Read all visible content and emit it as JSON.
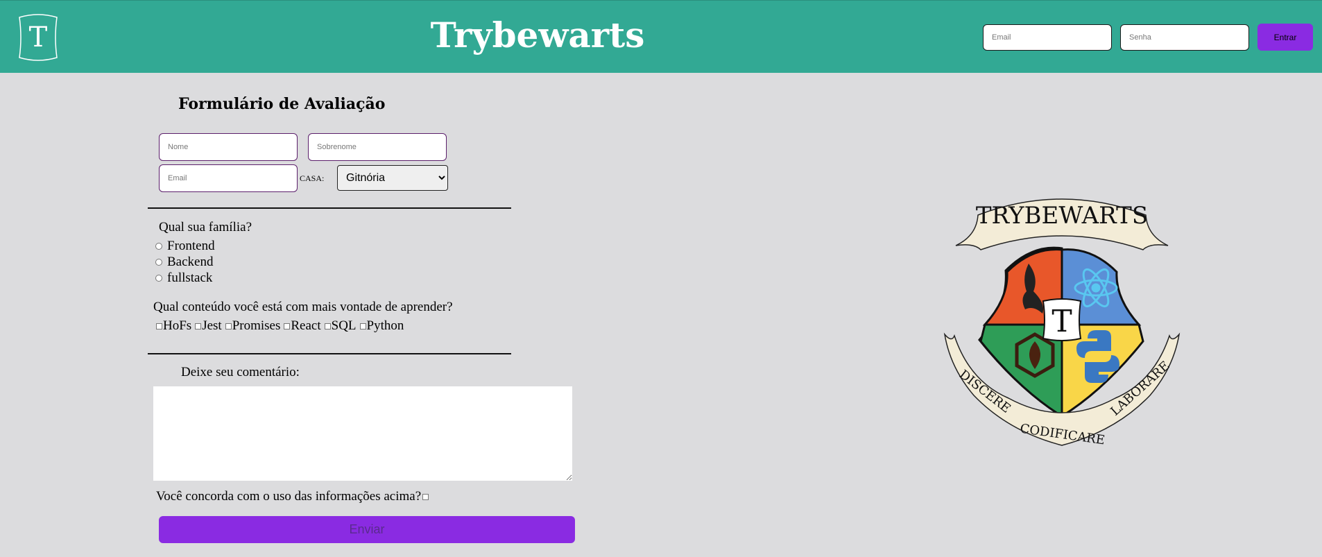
{
  "header": {
    "logo_letter": "T",
    "title": "Trybewarts",
    "login": {
      "email_placeholder": "Email",
      "password_placeholder": "Senha",
      "button_label": "Entrar"
    }
  },
  "form": {
    "title": "Formulário de Avaliação",
    "first_name_placeholder": "Nome",
    "last_name_placeholder": "Sobrenome",
    "email_placeholder": "Email",
    "house_label": "CASA:",
    "house_selected": "Gitnória",
    "family_question": "Qual sua família?",
    "family_options": [
      "Frontend",
      "Backend",
      "fullstack"
    ],
    "content_question": "Qual conteúdo você está com mais vontade de aprender?",
    "content_options": [
      "HoFs",
      "Jest",
      "Promises",
      "React",
      "SQL",
      "Python"
    ],
    "comment_label": "Deixe seu comentário:",
    "agree_label": "Você concorda com o uso das informações acima?",
    "submit_label": "Enviar"
  },
  "crest": {
    "banner_text": "TRYBEWARTS",
    "center_letter": "T",
    "motto": [
      "DISCERE",
      "CODIFICARE",
      "LABORARE"
    ],
    "colors": {
      "top_left": "#e8572a",
      "top_right": "#5b8fd6",
      "bottom_left": "#2e9d57",
      "bottom_right": "#f9d648",
      "scroll": "#f3ecd7"
    }
  },
  "colors": {
    "header_bg": "#32a994",
    "accent_purple": "#8a2be2",
    "page_bg": "#dcdcde"
  }
}
